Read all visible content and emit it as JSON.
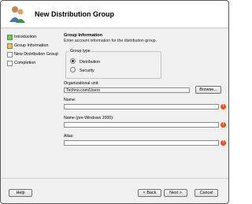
{
  "window": {
    "title": "New Distribution Group"
  },
  "nav": {
    "items": [
      {
        "label": "Introduction",
        "state": "done"
      },
      {
        "label": "Group Information",
        "state": "active"
      },
      {
        "label": "New Distribution Group",
        "state": "pending"
      },
      {
        "label": "Completion",
        "state": "pending"
      }
    ]
  },
  "content": {
    "section_title": "Group Information",
    "section_desc": "Enter account information for the distribution group.",
    "group_type": {
      "legend": "Group type",
      "options": [
        {
          "label": "Distribution",
          "selected": true
        },
        {
          "label": "Security",
          "selected": false
        }
      ]
    },
    "ou": {
      "label": "Organizational unit:",
      "value": "Techno.com/Users",
      "browse_label": "Browse..."
    },
    "name": {
      "label": "Name:",
      "value": ""
    },
    "name_pre2000": {
      "label": "Name (pre-Windows 2000):",
      "value": ""
    },
    "alias": {
      "label": "Alias:",
      "value": ""
    },
    "error_glyph": "!"
  },
  "footer": {
    "help": "Help",
    "back": "< Back",
    "next": "Next >",
    "cancel": "Cancel"
  }
}
